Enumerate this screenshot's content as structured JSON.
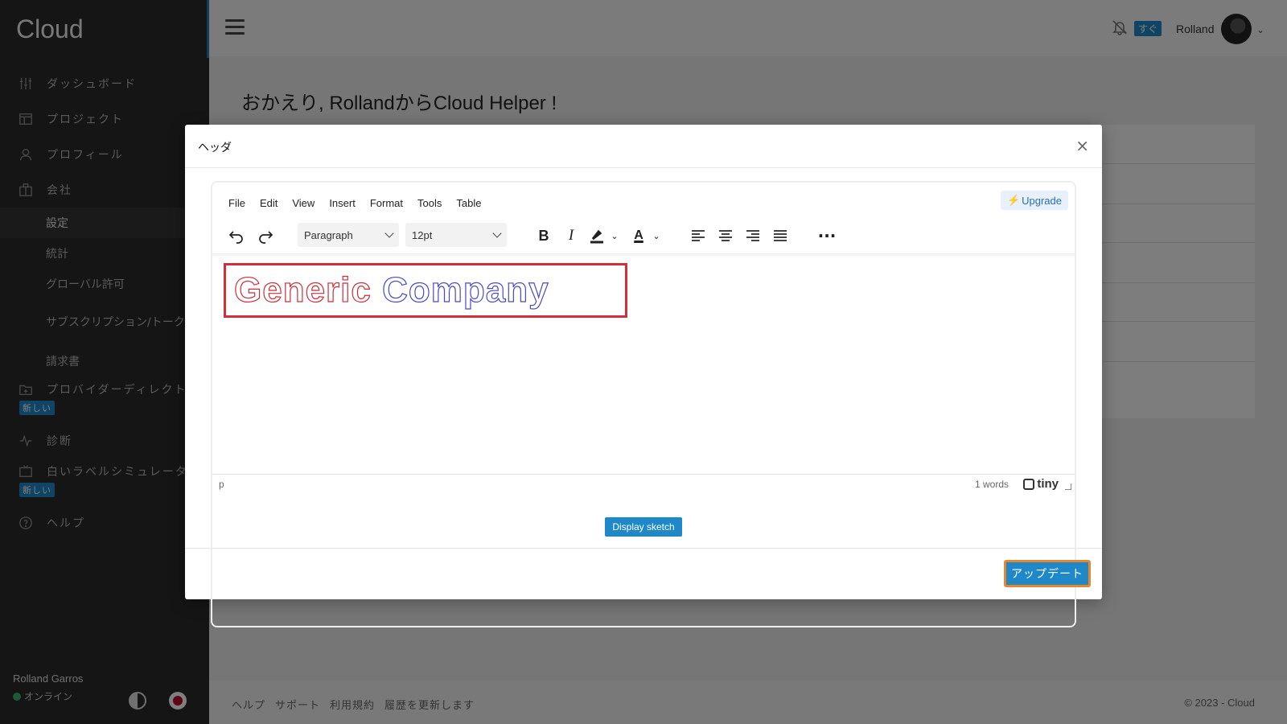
{
  "app": {
    "brand": "Cloud"
  },
  "sidebar": {
    "items": [
      {
        "label": "ダッシュボード",
        "icon": "sliders-icon"
      },
      {
        "label": "プロジェクト",
        "icon": "layout-icon"
      },
      {
        "label": "プロフィール",
        "icon": "user-icon"
      },
      {
        "label": "会社",
        "icon": "building-icon"
      }
    ],
    "sub_items": [
      "設定",
      "統計",
      "グローバル許可",
      "サブスクリプション/トークン",
      "請求書"
    ],
    "provider_label": "プロバイダーディレクトリ",
    "new_badge": "新しい",
    "diagnostics_label": "診断",
    "whitelabel_label": "白いラベルシミュレーター",
    "help_label": "ヘルプ",
    "user_name": "Rolland Garros",
    "user_status": "オンライン"
  },
  "topbar": {
    "soon_badge": "すぐ",
    "user_name": "Rolland"
  },
  "main": {
    "title": "おかえり, RollandからCloud Helper !"
  },
  "footer": {
    "links": [
      "ヘルプ",
      "サポート",
      "利用規約",
      "履歴を更新します"
    ],
    "copyright": "© 2023 - Cloud"
  },
  "modal": {
    "title": "ヘッダ",
    "close": "×",
    "menubar": [
      "File",
      "Edit",
      "View",
      "Insert",
      "Format",
      "Tools",
      "Table"
    ],
    "upgrade": "Upgrade",
    "block_format": "Paragraph",
    "font_size": "12pt",
    "content_word1": "Generic",
    "content_word2": "Company",
    "status_path": "p",
    "word_count": "1 words",
    "brand": "tiny",
    "display_button": "Display sketch",
    "update_button": "アップデート"
  },
  "colors": {
    "accent": "#1e88c9",
    "sidebar_bg": "#2b2b2b",
    "highlight_border": "#d0303a",
    "update_border": "#e8862c"
  }
}
